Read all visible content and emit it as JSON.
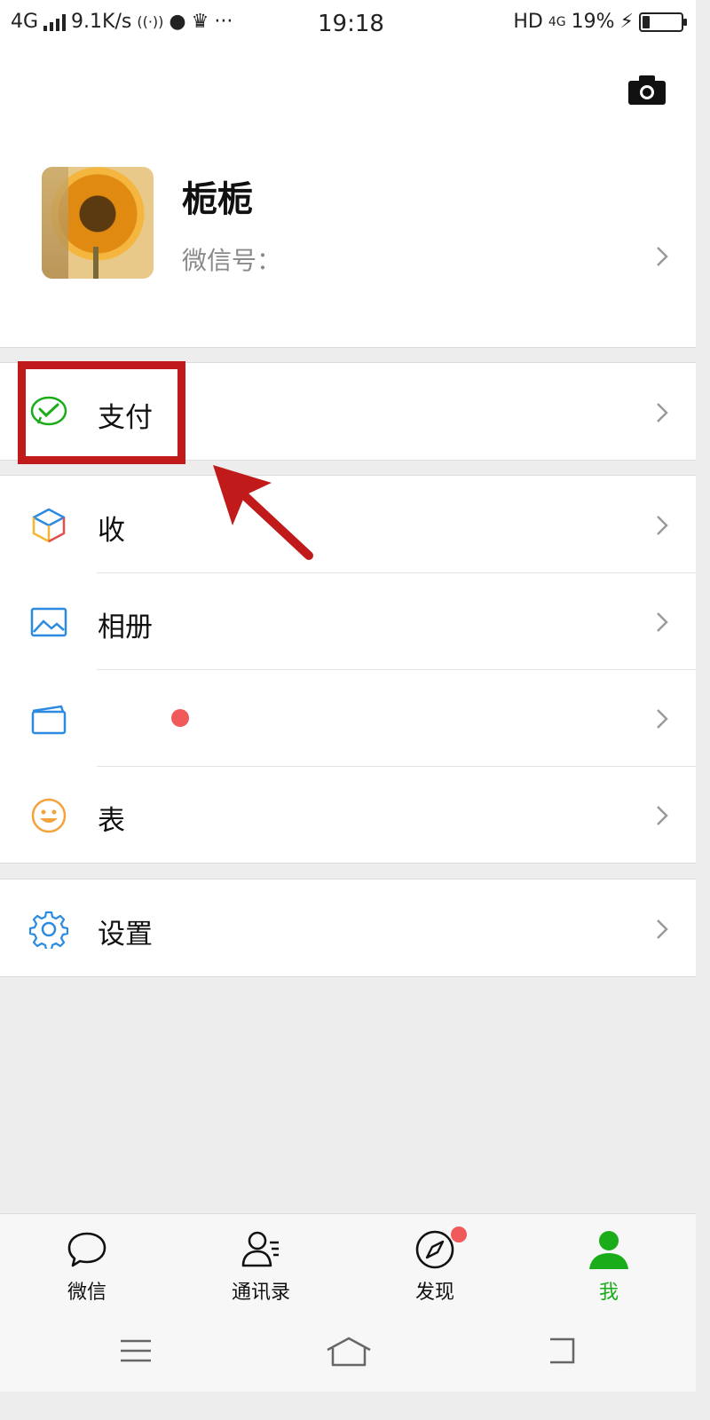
{
  "status_bar": {
    "network": "4G",
    "speed": "9.1K/s",
    "time": "19:18",
    "hd": "HD",
    "network_right": "4G",
    "battery": "19%",
    "battery_level": 0.19
  },
  "profile": {
    "name": "栀栀",
    "wechat_id_label": "微信号："
  },
  "menu": {
    "pay": {
      "label": "支付",
      "icon": "wechat-pay-icon"
    },
    "favorites": {
      "label": "收",
      "icon": "cube-icon"
    },
    "album": {
      "label": "相册",
      "icon": "picture-icon"
    },
    "cards": {
      "label": "",
      "icon": "card-icon"
    },
    "stickers": {
      "label": "表",
      "icon": "smiley-icon"
    },
    "settings": {
      "label": "设置",
      "icon": "gear-icon"
    }
  },
  "tabbar": {
    "tabs": [
      {
        "label": "微信",
        "icon": "chat-bubble-icon"
      },
      {
        "label": "通讯录",
        "icon": "contacts-icon"
      },
      {
        "label": "发现",
        "icon": "compass-icon"
      },
      {
        "label": "我",
        "icon": "person-icon"
      }
    ]
  },
  "colors": {
    "accent_green": "#1aad19",
    "highlight_red": "#c01a1a",
    "badge_red": "#f15a5a"
  }
}
